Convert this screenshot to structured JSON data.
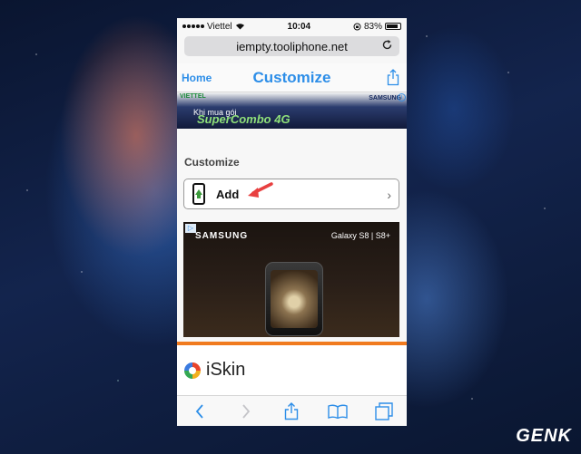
{
  "status_bar": {
    "carrier": "Viettel",
    "time": "10:04",
    "battery": "83%"
  },
  "browser": {
    "url": "iempty.tooliphone.net"
  },
  "nav": {
    "back_label": "Home",
    "title": "Customize"
  },
  "top_ad": {
    "brand_left": "VIETTEL",
    "brand_right": "SAMSUNG",
    "line1": "Khi mua gói",
    "line2": "SuperCombo 4G"
  },
  "content": {
    "section_title": "Customize",
    "add_row_label": "Add"
  },
  "banner_ad": {
    "brand": "SAMSUNG",
    "model": "Galaxy S8 | S8+"
  },
  "bottom_ad": {
    "name": "iSkin"
  },
  "watermark": {
    "text": "GENK"
  },
  "colors": {
    "accent": "#2d8ee8",
    "ad_stripe": "#f07a1e"
  }
}
